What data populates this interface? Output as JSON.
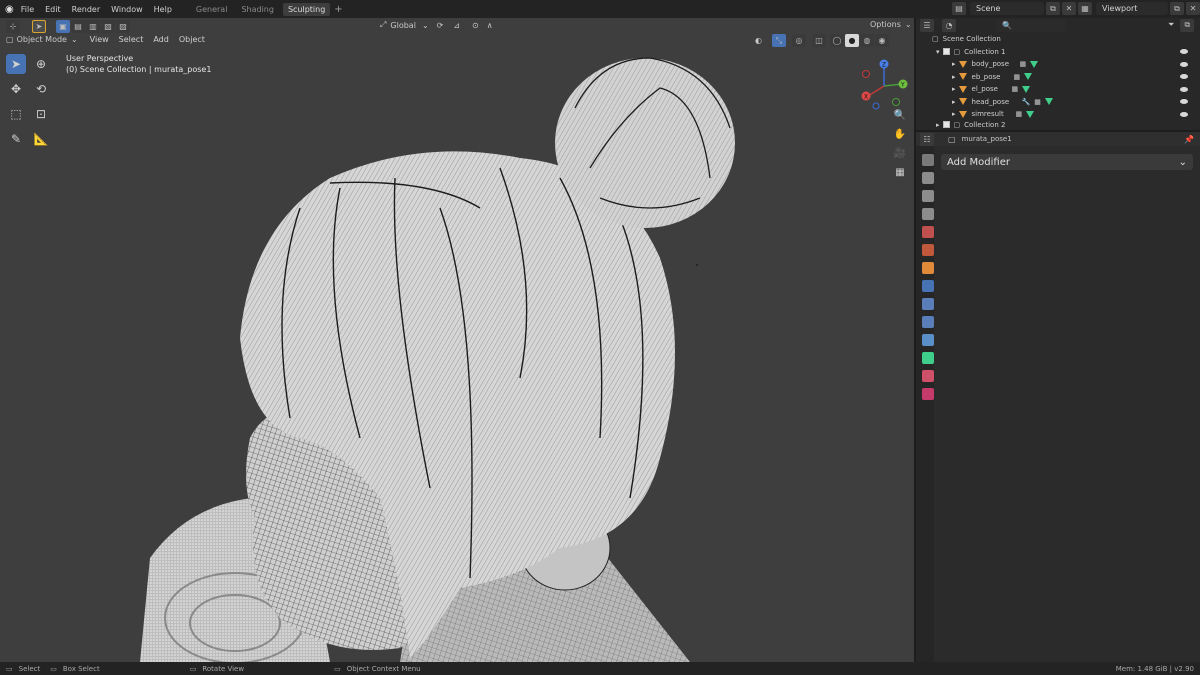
{
  "topbar": {
    "menus": [
      "File",
      "Edit",
      "Render",
      "Window",
      "Help"
    ],
    "workspace_tabs": [
      "General",
      "Shading",
      "Sculpting"
    ],
    "active_tab": "Sculpting",
    "add_tab": "+",
    "scene": "Scene",
    "view_layer": "Viewport"
  },
  "viewport": {
    "mode": "Object Mode",
    "menus": [
      "View",
      "Select",
      "Add",
      "Object"
    ],
    "orientation": "Global",
    "options": "Options",
    "perspective": "User Perspective",
    "collection_info": "(0) Scene Collection | murata_pose1",
    "gizmo_axes": [
      "X",
      "Y",
      "Z"
    ]
  },
  "outliner": {
    "root": "Scene Collection",
    "collection1": "Collection 1",
    "objects": [
      "body_pose",
      "eb_pose",
      "el_pose",
      "head_pose",
      "simresult"
    ],
    "collection2": "Collection 2"
  },
  "properties": {
    "object_name": "murata_pose1",
    "add_modifier": "Add Modifier"
  },
  "status": {
    "select": "Select",
    "box_select": "Box Select",
    "rotate_view": "Rotate View",
    "context_menu": "Object Context Menu",
    "memory": "Mem: 1.48 GiB | v2.90"
  },
  "colors": {
    "accent": "#4772b3",
    "viewport_bg": "#3e3e3e",
    "object_icon": "#e59a3c",
    "mesh_icon": "#3fcf8a"
  }
}
